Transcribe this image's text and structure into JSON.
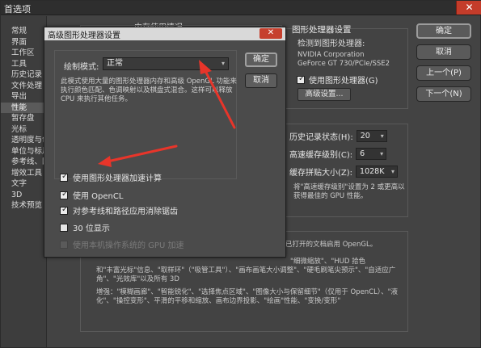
{
  "window": {
    "title": "首选项",
    "close_glyph": "✕"
  },
  "sidebar": {
    "items": [
      {
        "label": "常规"
      },
      {
        "label": "界面"
      },
      {
        "label": "工作区"
      },
      {
        "label": "工具"
      },
      {
        "label": "历史记录"
      },
      {
        "label": "文件处理"
      },
      {
        "label": "导出"
      },
      {
        "label": "性能"
      },
      {
        "label": "暂存盘"
      },
      {
        "label": "光标"
      },
      {
        "label": "透明度与色域"
      },
      {
        "label": "单位与标尺"
      },
      {
        "label": "参考线、网格"
      },
      {
        "label": "增效工具"
      },
      {
        "label": "文字"
      },
      {
        "label": "3D"
      },
      {
        "label": "技术预览"
      }
    ],
    "active_index": 7
  },
  "memory_group": {
    "label": "内存使用情况"
  },
  "gpu": {
    "header": "图形处理器设置",
    "detect_label": "检测到图形处理器:",
    "vendor": "NVIDIA Corporation",
    "model": "GeForce GT 730/PCIe/SSE2",
    "use_gpu_label": "使用图形处理器(G)",
    "use_gpu_checked": true,
    "advanced_button": "高级设置..."
  },
  "buttons": {
    "ok": "确定",
    "cancel": "取消",
    "prev": "上一个(P)",
    "next": "下一个(N)"
  },
  "history_cache": {
    "history_label": "历史记录状态(H):",
    "history_value": "20",
    "cache_levels_label": "高速缓存级别(C):",
    "cache_levels_value": "6",
    "tile_size_label": "缓存拼贴大小(Z):",
    "tile_size_value": "1028K",
    "hint": "将\"高速缓存级别\"设置为 2 或更高以获得最佳的 GPU 性能。"
  },
  "description": {
    "line1": "已打开的文档启用 OpenGL。",
    "line2": "和\"丰富光标\"信息、\"取样环\"（\"吸管工具\"）、\"画布画笔大小调整\"、\"硬毛刷笔尖预示\"、\"自适应广角\"、\"光效库\"以及所有 3D",
    "line3": "增强：\"模糊画廊\"、\"智能锐化\"、\"选择焦点区域\"、\"图像大小与保留细节\"（仅用于 OpenCL）、\"液化\"、\"操控变形\"、平滑的平移和缩放、画布边界投影、\"绘画\"性能、\"变换/变形\""
  },
  "desc_partial_right": "\"细微缩放\"、\"HUD 拾色",
  "modal": {
    "title": "高级图形处理器设置",
    "close_glyph": "✕",
    "draw_mode_label": "绘制模式:",
    "draw_mode_value": "正常",
    "ok": "确定",
    "cancel": "取消",
    "description": "此模式使用大量的图形处理器内存和高级 OpenGL 功能来执行颜色匹配、色调映射以及棋盘式混合。这样可以释放 CPU 来执行其他任务。",
    "options": [
      {
        "label": "使用图形处理器加速计算",
        "checked": true,
        "disabled": false
      },
      {
        "label": "使用 OpenCL",
        "checked": true,
        "disabled": false
      },
      {
        "label": "对参考线和路径应用消除锯齿",
        "checked": true,
        "disabled": false
      },
      {
        "label": "30 位显示",
        "checked": false,
        "disabled": false
      },
      {
        "label": "使用本机操作系统的 GPU 加速",
        "checked": false,
        "disabled": true
      }
    ]
  },
  "colors": {
    "window_bg": "#434343",
    "modal_title_bg": "#d9d9d9",
    "close_red": "#c43c2a",
    "annotation_red": "#e8352a"
  }
}
